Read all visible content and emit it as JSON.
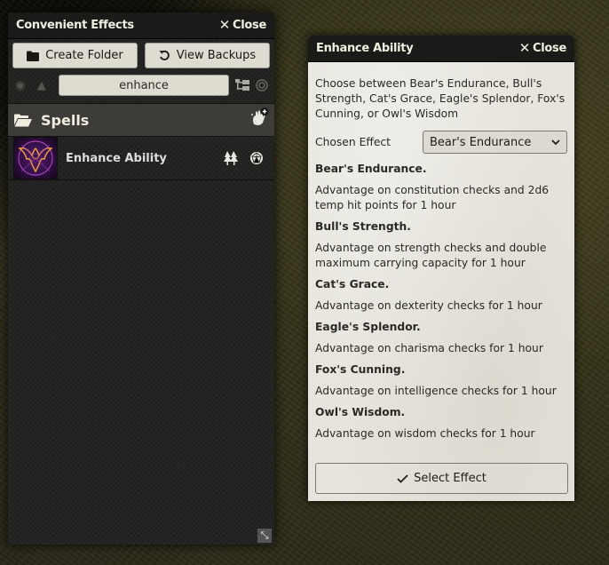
{
  "convenient_effects": {
    "title": "Convenient Effects",
    "close_label": "Close",
    "buttons": {
      "create_folder": "Create Folder",
      "view_backups": "View Backups"
    },
    "search": {
      "value": "enhance",
      "placeholder": ""
    },
    "icons": {
      "toggle_visibility": "eye-icon",
      "toggle_nested": "tree-icon",
      "collapse_all": "folder-tree-icon",
      "show_status": "target-icon"
    },
    "folders": [
      {
        "name": "Spells",
        "effects": [
          {
            "name": "Enhance Ability",
            "icons": [
              "nested-effects-icon",
              "dnd-dice-icon"
            ]
          }
        ]
      }
    ]
  },
  "dialog": {
    "title": "Enhance Ability",
    "close_label": "Close",
    "intro": "Choose between Bear's Endurance, Bull's Strength, Cat's Grace, Eagle's Splendor, Fox's Cunning, or Owl's Wisdom",
    "chosen_effect_label": "Chosen Effect",
    "chosen_effect_value": "Bear's Endurance",
    "options": [
      {
        "title": "Bear's Endurance.",
        "desc": "Advantage on constitution checks and 2d6 temp hit points for 1 hour"
      },
      {
        "title": "Bull's Strength.",
        "desc": "Advantage on strength checks and double maximum carrying capacity for 1 hour"
      },
      {
        "title": "Cat's Grace.",
        "desc": "Advantage on dexterity checks for 1 hour"
      },
      {
        "title": "Eagle's Splendor.",
        "desc": "Advantage on charisma checks for 1 hour"
      },
      {
        "title": "Fox's Cunning.",
        "desc": "Advantage on intelligence checks for 1 hour"
      },
      {
        "title": "Owl's Wisdom.",
        "desc": "Advantage on wisdom checks for 1 hour"
      }
    ],
    "select_button": "Select Effect"
  }
}
